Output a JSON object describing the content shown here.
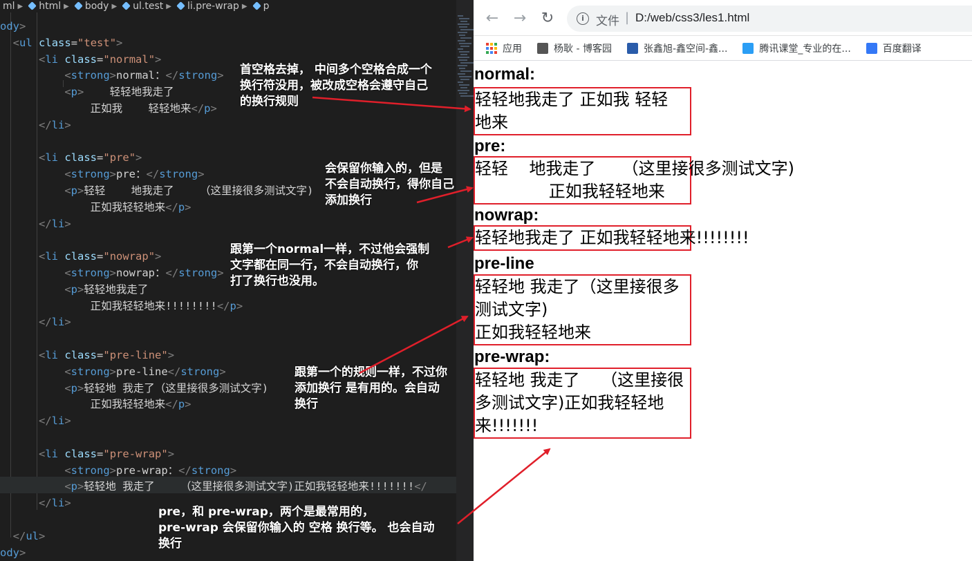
{
  "editor": {
    "breadcrumb": [
      "ml",
      "html",
      "body",
      "ul.test",
      "li.pre-wrap",
      "p"
    ],
    "code": [
      {
        "t": [
          [
            "tag",
            "ody"
          ],
          [
            "br",
            ">"
          ]
        ]
      },
      {
        "t": [
          [
            "tx",
            "  "
          ],
          [
            "br",
            "<"
          ],
          [
            "tag",
            "ul"
          ],
          [
            "tx",
            " "
          ],
          [
            "at",
            "class"
          ],
          [
            "tx",
            "="
          ],
          [
            "st",
            "\"test\""
          ],
          [
            "br",
            ">"
          ]
        ]
      },
      {
        "t": [
          [
            "tx",
            "      "
          ],
          [
            "br",
            "<"
          ],
          [
            "tag",
            "li"
          ],
          [
            "tx",
            " "
          ],
          [
            "at",
            "class"
          ],
          [
            "tx",
            "="
          ],
          [
            "st",
            "\"normal\""
          ],
          [
            "br",
            ">"
          ]
        ]
      },
      {
        "t": [
          [
            "tx",
            "          "
          ],
          [
            "br",
            "<"
          ],
          [
            "tag",
            "strong"
          ],
          [
            "br",
            ">"
          ],
          [
            "tx",
            "normal："
          ],
          [
            "br",
            "</"
          ],
          [
            "tag",
            "strong"
          ],
          [
            "br",
            ">"
          ]
        ]
      },
      {
        "t": [
          [
            "tx",
            "          "
          ],
          [
            "br",
            "<"
          ],
          [
            "tag",
            "p"
          ],
          [
            "br",
            ">"
          ],
          [
            "tx",
            "    轻轻地我走了"
          ]
        ]
      },
      {
        "t": [
          [
            "tx",
            "              正如我    轻轻地来"
          ],
          [
            "br",
            "</"
          ],
          [
            "tag",
            "p"
          ],
          [
            "br",
            ">"
          ]
        ]
      },
      {
        "t": [
          [
            "tx",
            "      "
          ],
          [
            "br",
            "</"
          ],
          [
            "tag",
            "li"
          ],
          [
            "br",
            ">"
          ]
        ]
      },
      {
        "t": []
      },
      {
        "t": [
          [
            "tx",
            "      "
          ],
          [
            "br",
            "<"
          ],
          [
            "tag",
            "li"
          ],
          [
            "tx",
            " "
          ],
          [
            "at",
            "class"
          ],
          [
            "tx",
            "="
          ],
          [
            "st",
            "\"pre\""
          ],
          [
            "br",
            ">"
          ]
        ]
      },
      {
        "t": [
          [
            "tx",
            "          "
          ],
          [
            "br",
            "<"
          ],
          [
            "tag",
            "strong"
          ],
          [
            "br",
            ">"
          ],
          [
            "tx",
            "pre："
          ],
          [
            "br",
            "</"
          ],
          [
            "tag",
            "strong"
          ],
          [
            "br",
            ">"
          ]
        ]
      },
      {
        "t": [
          [
            "tx",
            "          "
          ],
          [
            "br",
            "<"
          ],
          [
            "tag",
            "p"
          ],
          [
            "br",
            ">"
          ],
          [
            "tx",
            "轻轻    地我走了    （这里接很多测试文字)"
          ]
        ]
      },
      {
        "t": [
          [
            "tx",
            "              正如我轻轻地来"
          ],
          [
            "br",
            "</"
          ],
          [
            "tag",
            "p"
          ],
          [
            "br",
            ">"
          ]
        ]
      },
      {
        "t": [
          [
            "tx",
            "      "
          ],
          [
            "br",
            "</"
          ],
          [
            "tag",
            "li"
          ],
          [
            "br",
            ">"
          ]
        ]
      },
      {
        "t": []
      },
      {
        "t": [
          [
            "tx",
            "      "
          ],
          [
            "br",
            "<"
          ],
          [
            "tag",
            "li"
          ],
          [
            "tx",
            " "
          ],
          [
            "at",
            "class"
          ],
          [
            "tx",
            "="
          ],
          [
            "st",
            "\"nowrap\""
          ],
          [
            "br",
            ">"
          ]
        ]
      },
      {
        "t": [
          [
            "tx",
            "          "
          ],
          [
            "br",
            "<"
          ],
          [
            "tag",
            "strong"
          ],
          [
            "br",
            ">"
          ],
          [
            "tx",
            "nowrap："
          ],
          [
            "br",
            "</"
          ],
          [
            "tag",
            "strong"
          ],
          [
            "br",
            ">"
          ]
        ]
      },
      {
        "t": [
          [
            "tx",
            "          "
          ],
          [
            "br",
            "<"
          ],
          [
            "tag",
            "p"
          ],
          [
            "br",
            ">"
          ],
          [
            "tx",
            "轻轻地我走了"
          ]
        ]
      },
      {
        "t": [
          [
            "tx",
            "              正如我轻轻地来!!!!!!!!"
          ],
          [
            "br",
            "</"
          ],
          [
            "tag",
            "p"
          ],
          [
            "br",
            ">"
          ]
        ]
      },
      {
        "t": [
          [
            "tx",
            "      "
          ],
          [
            "br",
            "</"
          ],
          [
            "tag",
            "li"
          ],
          [
            "br",
            ">"
          ]
        ]
      },
      {
        "t": []
      },
      {
        "t": [
          [
            "tx",
            "      "
          ],
          [
            "br",
            "<"
          ],
          [
            "tag",
            "li"
          ],
          [
            "tx",
            " "
          ],
          [
            "at",
            "class"
          ],
          [
            "tx",
            "="
          ],
          [
            "st",
            "\"pre-line\""
          ],
          [
            "br",
            ">"
          ]
        ]
      },
      {
        "t": [
          [
            "tx",
            "          "
          ],
          [
            "br",
            "<"
          ],
          [
            "tag",
            "strong"
          ],
          [
            "br",
            ">"
          ],
          [
            "tx",
            "pre-line"
          ],
          [
            "br",
            "</"
          ],
          [
            "tag",
            "strong"
          ],
          [
            "br",
            ">"
          ]
        ]
      },
      {
        "t": [
          [
            "tx",
            "          "
          ],
          [
            "br",
            "<"
          ],
          [
            "tag",
            "p"
          ],
          [
            "br",
            ">"
          ],
          [
            "tx",
            "轻轻地 我走了（这里接很多测试文字)"
          ]
        ]
      },
      {
        "t": [
          [
            "tx",
            "              正如我轻轻地来"
          ],
          [
            "br",
            "</"
          ],
          [
            "tag",
            "p"
          ],
          [
            "br",
            ">"
          ]
        ]
      },
      {
        "t": [
          [
            "tx",
            "      "
          ],
          [
            "br",
            "</"
          ],
          [
            "tag",
            "li"
          ],
          [
            "br",
            ">"
          ]
        ]
      },
      {
        "t": []
      },
      {
        "t": [
          [
            "tx",
            "      "
          ],
          [
            "br",
            "<"
          ],
          [
            "tag",
            "li"
          ],
          [
            "tx",
            " "
          ],
          [
            "at",
            "class"
          ],
          [
            "tx",
            "="
          ],
          [
            "st",
            "\"pre-wrap\""
          ],
          [
            "br",
            ">"
          ]
        ]
      },
      {
        "t": [
          [
            "tx",
            "          "
          ],
          [
            "br",
            "<"
          ],
          [
            "tag",
            "strong"
          ],
          [
            "br",
            ">"
          ],
          [
            "tx",
            "pre-wrap："
          ],
          [
            "br",
            "</"
          ],
          [
            "tag",
            "strong"
          ],
          [
            "br",
            ">"
          ]
        ]
      },
      {
        "t": [
          [
            "tx",
            "          "
          ],
          [
            "br",
            "<"
          ],
          [
            "tag",
            "p"
          ],
          [
            "br",
            ">"
          ],
          [
            "tx",
            "轻轻地 我走了    （这里接很多测试文字)正如我轻轻地来!!!!!!!"
          ],
          [
            "br",
            "</"
          ]
        ]
      },
      {
        "t": [
          [
            "tx",
            "      "
          ],
          [
            "br",
            "</"
          ],
          [
            "tag",
            "li"
          ],
          [
            "br",
            ">"
          ]
        ]
      },
      {
        "t": []
      },
      {
        "t": [
          [
            "tx",
            "  "
          ],
          [
            "br",
            "</"
          ],
          [
            "tag",
            "ul"
          ],
          [
            "br",
            ">"
          ]
        ]
      },
      {
        "t": [
          [
            "tag",
            "ody"
          ],
          [
            "br",
            ">"
          ]
        ]
      }
    ]
  },
  "browser": {
    "back_icon": "arrow-left-icon",
    "forward_icon": "arrow-right-icon",
    "reload_icon": "reload-icon",
    "scheme_label": "文件",
    "url": "D:/web/css3/les1.html",
    "bookmarks": [
      {
        "label": "应用",
        "icon": "apps-icon",
        "color": "#4285f4"
      },
      {
        "label": "杨耿 - 博客园",
        "icon": "blog-icon",
        "color": "#555555"
      },
      {
        "label": "张鑫旭-鑫空间-鑫...",
        "icon": "site-icon",
        "color": "#2a5caa"
      },
      {
        "label": "腾讯课堂_专业的在...",
        "icon": "tencent-icon",
        "color": "#2b9ef5"
      },
      {
        "label": "百度翻译",
        "icon": "translate-icon",
        "color": "#3478f6"
      }
    ]
  },
  "page": {
    "items": [
      {
        "heading": "normal:",
        "lines": [
          "轻轻地我走了 正如我 轻轻",
          "地来"
        ]
      },
      {
        "heading": "pre:",
        "lines": [
          "轻轻    地我走了     （这里接很多测试文字)",
          "              正如我轻轻地来"
        ]
      },
      {
        "heading": "nowrap:",
        "lines": [
          "轻轻地我走了 正如我轻轻地来!!!!!!!!"
        ]
      },
      {
        "heading": "pre-line",
        "lines": [
          "轻轻地 我走了（这里接很多",
          "测试文字)",
          "正如我轻轻地来"
        ]
      },
      {
        "heading": "pre-wrap:",
        "lines": [
          "轻轻地 我走了    （这里接很",
          "多测试文字)正如我轻轻地",
          "来!!!!!!!"
        ]
      }
    ]
  },
  "annotations": {
    "normal": [
      "首空格去掉， 中间多个空格合成一个",
      "换行符没用，被改成空格会遵守自己",
      "的换行规则"
    ],
    "pre": [
      "会保留你输入的，但是",
      "不会自动换行，得你自己",
      "添加换行"
    ],
    "nowrap": [
      "跟第一个normal一样，不过他会强制",
      "文字都在同一行，不会自动换行，你",
      "打了换行也没用。"
    ],
    "preline": [
      "跟第一个的规则一样，不过你",
      "添加换行 是有用的。会自动",
      "换行"
    ],
    "prewrap": [
      "pre，和 pre-wrap，两个是最常用的，",
      "pre-wrap 会保留你输入的  空格 换行等。 也会自动",
      "换行"
    ]
  },
  "colors": {
    "annotation_arrow": "#e01f2a",
    "box_border": "#e01f2a"
  }
}
